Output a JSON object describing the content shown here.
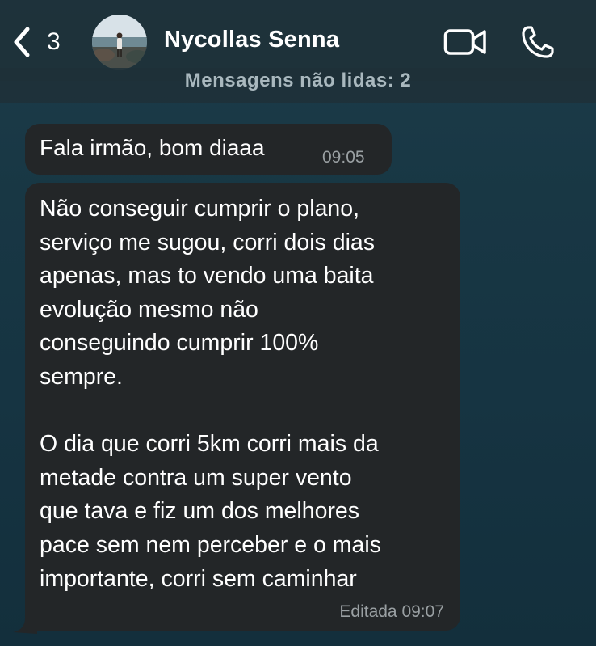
{
  "header": {
    "unread_count": "3",
    "contact_name": "Nycollas Senna",
    "back_icon": "chevron-left-icon",
    "video_icon": "video-camera-icon",
    "call_icon": "phone-icon"
  },
  "banner": {
    "label": "Mensagens não lidas: 2"
  },
  "messages": [
    {
      "text": "Fala irmão, bom diaaa",
      "time": "09:05"
    },
    {
      "text": "Não conseguir cumprir o plano,\nserviço me sugou, corri dois dias\napenas, mas to vendo uma baita\nevolução mesmo não\nconseguindo cumprir 100%\nsempre.\n\nO dia que corri 5km corri mais da\nmetade contra um super vento\nque tava e fiz um dos melhores\npace sem nem perceber e o mais\nimportante, corri sem caminhar",
      "time": "Editada 09:07"
    }
  ],
  "colors": {
    "bubble": "#232628",
    "background": "#163442",
    "header": "#1e323a",
    "timestamp": "#9aa0a3"
  }
}
